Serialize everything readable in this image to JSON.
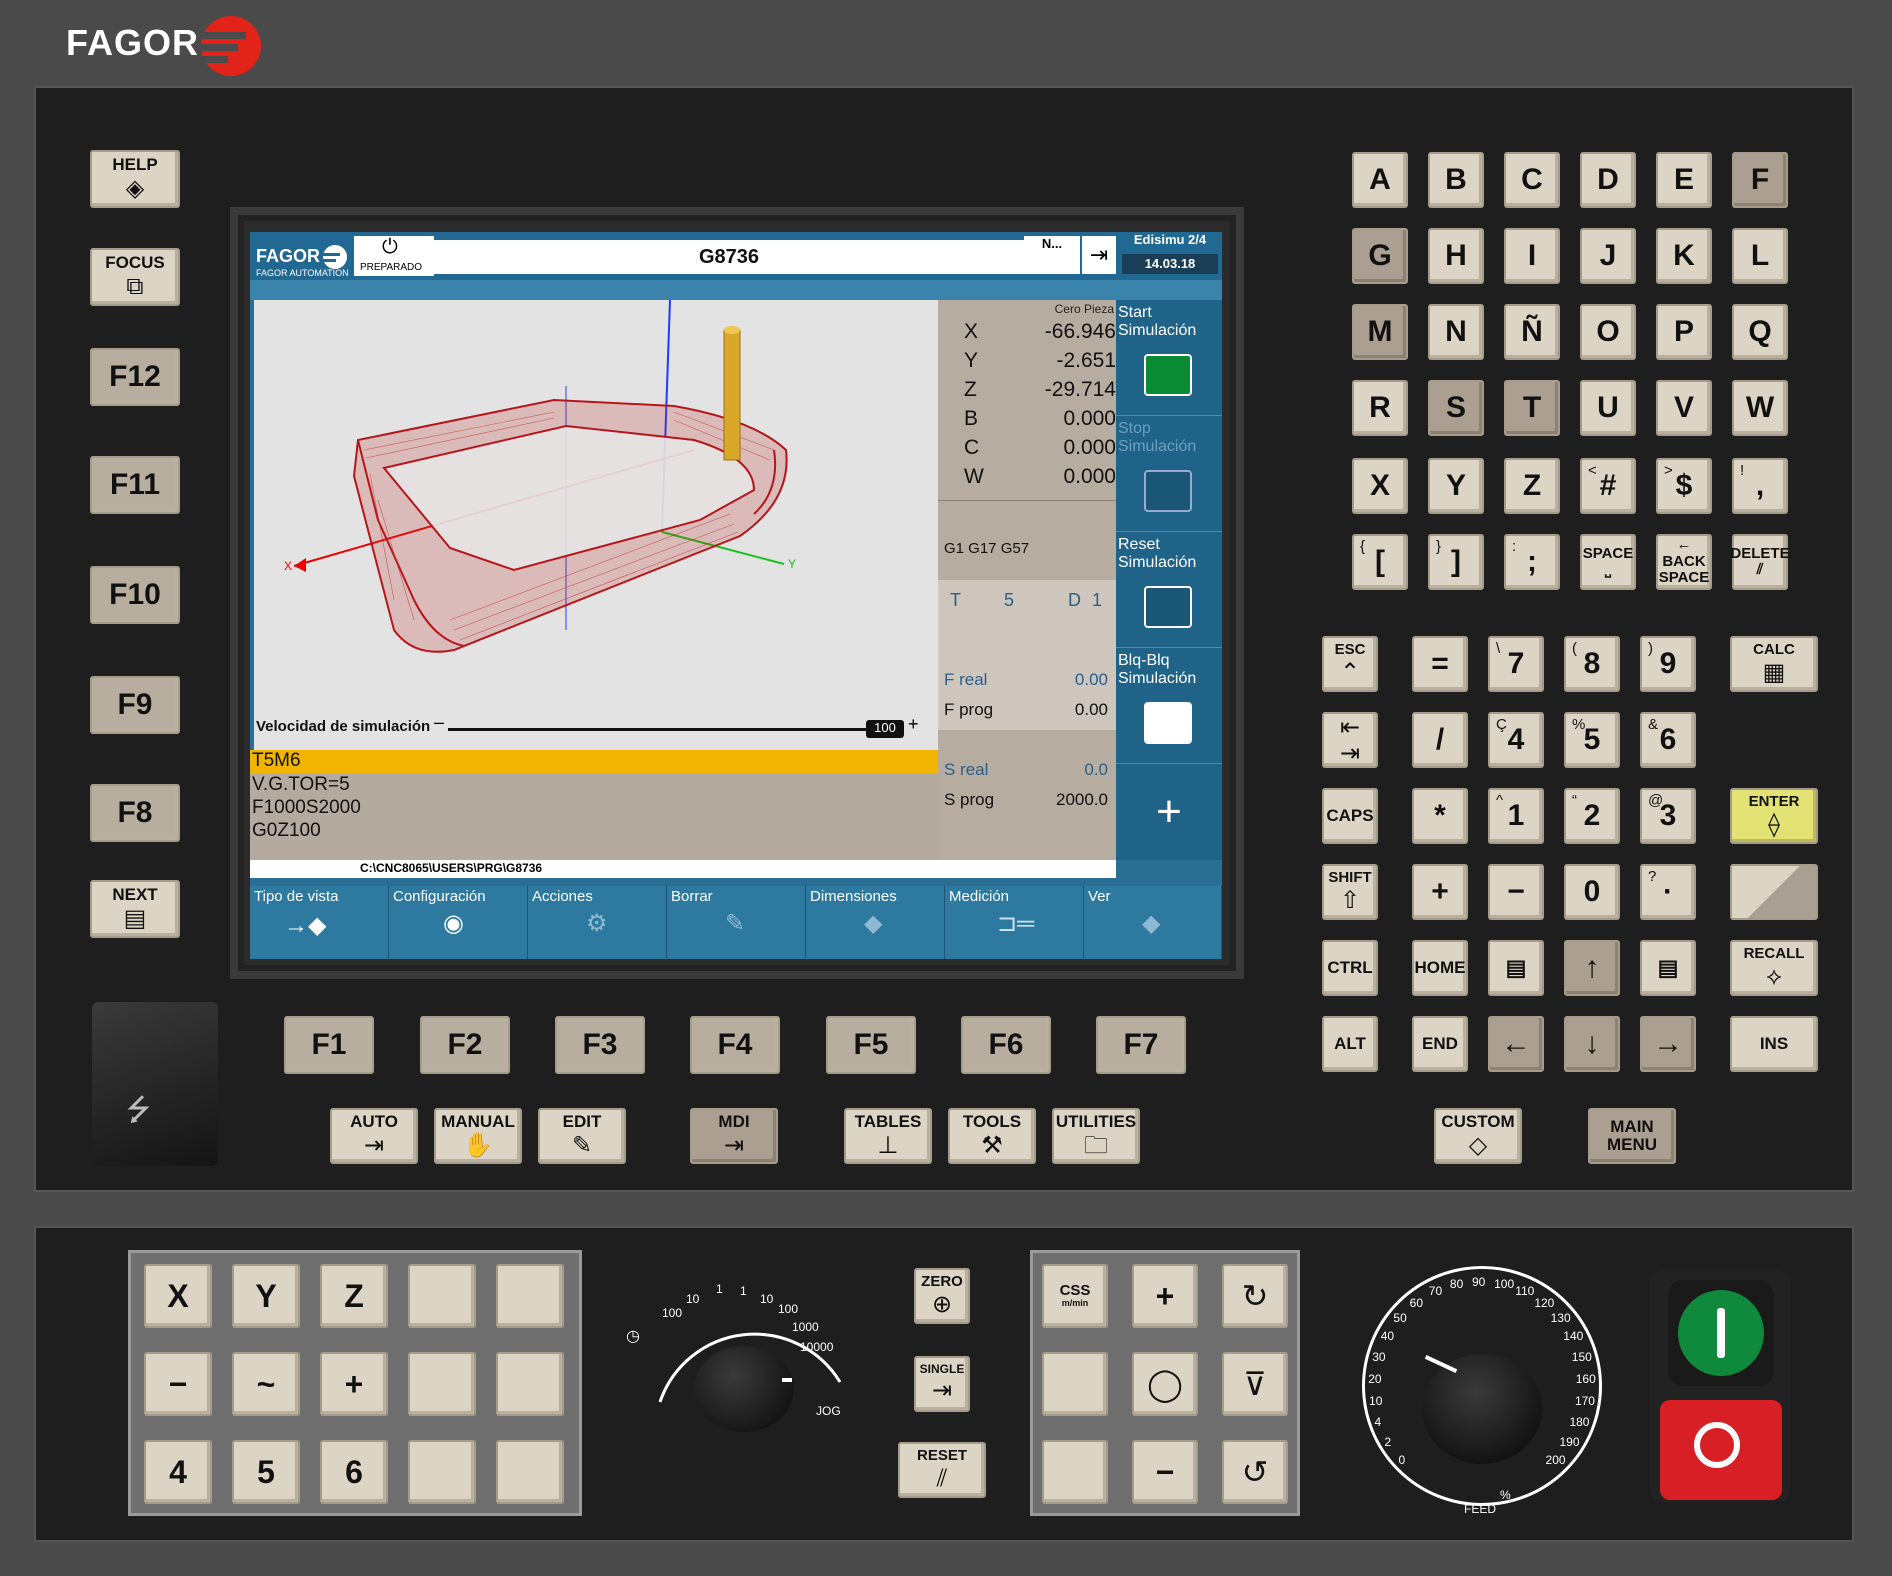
{
  "brand": {
    "name": "FAGOR",
    "color": "#e2231a"
  },
  "left_keys": {
    "help": "HELP",
    "focus": "FOCUS",
    "f12": "F12",
    "f11": "F11",
    "f10": "F10",
    "f9": "F9",
    "f8": "F8",
    "next": "NEXT"
  },
  "screen": {
    "logo": "FAGOR",
    "logo_sub": "FAGOR AUTOMATION",
    "status": "PREPARADO",
    "program": "G8736",
    "n_label": "N...",
    "top_right_title": "Edisimu 2/4",
    "date": "14.03.18",
    "coord_header": "Cero Pieza",
    "coords": [
      {
        "axis": "X",
        "value": "-66.946"
      },
      {
        "axis": "Y",
        "value": "-2.651"
      },
      {
        "axis": "Z",
        "value": "-29.714"
      },
      {
        "axis": "B",
        "value": "0.000"
      },
      {
        "axis": "C",
        "value": "0.000"
      },
      {
        "axis": "W",
        "value": "0.000"
      }
    ],
    "gcodes": "G1 G17 G57",
    "tool": {
      "t_label": "T",
      "t_value": "5",
      "d_label": "D",
      "d_value": "1"
    },
    "feed": {
      "real_label": "F real",
      "real_value": "0.00",
      "prog_label": "F prog",
      "prog_value": "0.00"
    },
    "spindle": {
      "real_label": "S real",
      "real_value": "0.0",
      "prog_label": "S prog",
      "prog_value": "2000.0"
    },
    "sim_speed_label": "Velocidad de simulación",
    "sim_speed_value": "100",
    "program_lines": [
      "T5M6",
      "V.G.TOR=5",
      "F1000S2000",
      "G0Z100"
    ],
    "path": "C:\\CNC8065\\USERS\\PRG\\G8736",
    "side_buttons": [
      {
        "l1": "Start",
        "l2": "Simulación"
      },
      {
        "l1": "Stop",
        "l2": "Simulación"
      },
      {
        "l1": "Reset",
        "l2": "Simulación"
      },
      {
        "l1": "Blq-Blq",
        "l2": "Simulación"
      }
    ],
    "softkeys": [
      "Tipo de vista",
      "Configuración",
      "Acciones",
      "Borrar",
      "Dimensiones",
      "Medición",
      "Ver"
    ],
    "axis_x": "X",
    "axis_y": "Y"
  },
  "fkeys": [
    "F1",
    "F2",
    "F3",
    "F4",
    "F5",
    "F6",
    "F7"
  ],
  "mode_keys": {
    "auto": "AUTO",
    "manual": "MANUAL",
    "edit": "EDIT",
    "mdi": "MDI",
    "tables": "TABLES",
    "tools": "TOOLS",
    "utilities": "UTILITIES",
    "custom": "CUSTOM",
    "main_menu_1": "MAIN",
    "main_menu_2": "MENU"
  },
  "alpha_rows": [
    [
      "A",
      "B",
      "C",
      "D",
      "E",
      "F"
    ],
    [
      "G",
      "H",
      "I",
      "J",
      "K",
      "L"
    ],
    [
      "M",
      "N",
      "Ñ",
      "O",
      "P",
      "Q"
    ],
    [
      "R",
      "S",
      "T",
      "U",
      "V",
      "W"
    ],
    [
      "X",
      "Y",
      "Z",
      "#",
      "$",
      ","
    ]
  ],
  "sym_row": {
    "bracket_l": "[",
    "bracket_r": "]",
    "semicolon": ";",
    "space": "SPACE",
    "backspace_1": "BACK",
    "backspace_2": "SPACE",
    "delete": "DELETE",
    "sup_lt": "<",
    "sup_gt": ">",
    "sup_excl": "!",
    "sup_brace_l": "{",
    "sup_brace_r": "}",
    "sup_colon": ":"
  },
  "numpad": {
    "esc": "ESC",
    "eq": "=",
    "n7": "7",
    "n8": "8",
    "n9": "9",
    "calc": "CALC",
    "slash": "/",
    "n4": "4",
    "n5": "5",
    "n6": "6",
    "caps": "CAPS",
    "star": "*",
    "n1": "1",
    "n2": "2",
    "n3": "3",
    "enter": "ENTER",
    "shift": "SHIFT",
    "plus": "+",
    "minus": "−",
    "n0": "0",
    "dot": "·",
    "ctrl": "CTRL",
    "home": "HOME",
    "recall": "RECALL",
    "alt": "ALT",
    "end": "END",
    "ins": "INS",
    "sup_bs": "\\",
    "sup_paren_l": "(",
    "sup_paren_r": ")",
    "sup_c": "Ç",
    "sup_pct": "%",
    "sup_amp": "&",
    "sup_caret": "^",
    "sup_quote": "“",
    "sup_at": "@",
    "sup_q": "?"
  },
  "jog_keys": {
    "x": "X",
    "y": "Y",
    "z": "Z",
    "minus": "−",
    "rapid": "~",
    "plus": "+",
    "n4": "4",
    "n5": "5",
    "n6": "6"
  },
  "jog_dial": {
    "labels": [
      "100",
      "10",
      "1",
      "1",
      "10",
      "100",
      "1000",
      "10000"
    ],
    "jog": "JOG"
  },
  "mid_keys": {
    "zero": "ZERO",
    "single": "SINGLE",
    "reset": "RESET"
  },
  "spindle_keys": {
    "css": "CSS",
    "css_unit": "m/min",
    "plus": "+",
    "minus": "−"
  },
  "feed_dial": {
    "labels": [
      "0",
      "2",
      "4",
      "10",
      "20",
      "30",
      "40",
      "50",
      "60",
      "70",
      "80",
      "90",
      "100",
      "110",
      "120",
      "130",
      "140",
      "150",
      "160",
      "170",
      "180",
      "190",
      "200"
    ],
    "feed": "FEED",
    "unit": "%"
  },
  "colors": {
    "start_green": "#0f8a3c",
    "stop_red": "#d81f26",
    "enter_yellow": "#e3e275",
    "highlight": "#f2b400"
  }
}
